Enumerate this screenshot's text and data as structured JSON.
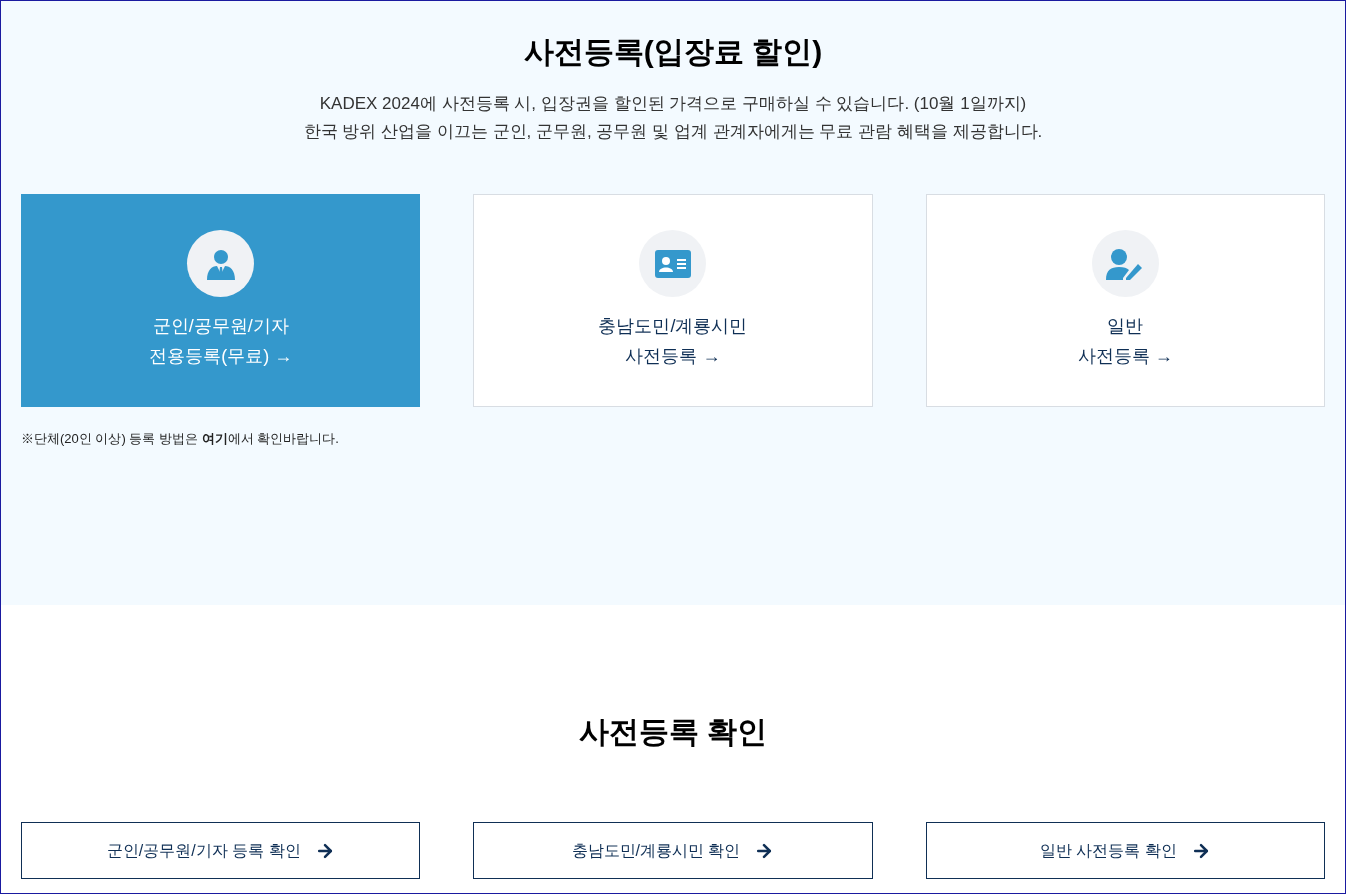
{
  "registration": {
    "title": "사전등록(입장료 할인)",
    "description": [
      "KADEX 2024에 사전등록 시, 입장권을 할인된 가격으로 구매하실 수 있습니다. (10월 1일까지)",
      "한국 방위 산업을 이끄는 군인, 군무원, 공무원 및 업계 관계자에게는 무료 관람 혜택을 제공합니다."
    ],
    "cards": [
      {
        "kind": "official",
        "lines": [
          "군인/공무원/기자",
          "전용등록(무료) →"
        ],
        "selected": true
      },
      {
        "kind": "resident",
        "lines": [
          "충남도민/계룡시민",
          "사전등록 →"
        ],
        "selected": false
      },
      {
        "kind": "general",
        "lines": [
          "일반",
          "사전등록 →"
        ],
        "selected": false
      }
    ],
    "note": "※단체(20인 이상) 등록 방법은 **여기**에서 확인바랍니다."
  },
  "confirmation": {
    "title": "사전등록 확인",
    "buttons": [
      "군인/공무원/기자 등록 확인",
      "충남도민/계룡시민 확인",
      "일반 사전등록 확인"
    ]
  }
}
